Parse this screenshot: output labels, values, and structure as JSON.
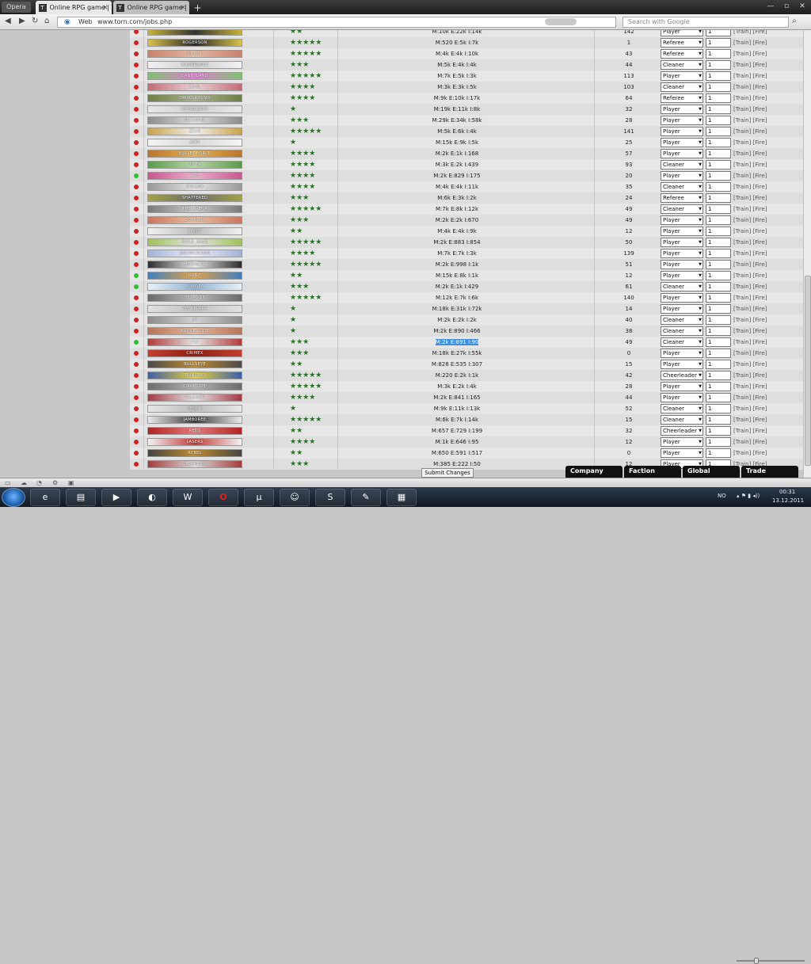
{
  "browser": {
    "menu_label": "Opera",
    "tabs": [
      {
        "label": "Online RPG game | TO...",
        "favicon": "T",
        "active": true
      },
      {
        "label": "Online RPG game | TO...",
        "favicon": "T",
        "active": false
      }
    ],
    "new_tab": "+",
    "address_label": "Web",
    "url": "www.torn.com/jobs.php",
    "search_placeholder": "Search with Google"
  },
  "jobs": {
    "rows": [
      {
        "status": "red",
        "name": "",
        "stars": "★★",
        "stats": "M:10k E:22k I:14k",
        "count": "142",
        "role": "Player",
        "qty": "1",
        "actions": "[Train] [Fire]",
        "colors": [
          "#c9b43a",
          "#333"
        ]
      },
      {
        "status": "red",
        "name": "ROGERSON",
        "stars": "★★★★★",
        "stats": "M:520 E:5k I:7k",
        "count": "1",
        "role": "Referee",
        "qty": "1",
        "actions": "[Train] [Fire]",
        "colors": [
          "#d8c24a",
          "#2a2a2a"
        ]
      },
      {
        "status": "red",
        "name": "JD-LIFT",
        "stars": "★★★★★",
        "stats": "M:4k E:4k I:10k",
        "count": "43",
        "role": "Referee",
        "qty": "1",
        "actions": "[Train] [Fire]",
        "colors": [
          "#c7816a",
          "#e3b9a1"
        ]
      },
      {
        "status": "red",
        "name": "QUADRANGE",
        "stars": "★★★",
        "stats": "M:5k E:4k I:4k",
        "count": "44",
        "role": "Cleaner",
        "qty": "1",
        "actions": "[Train] [Fire]",
        "colors": [
          "#f2f2f2",
          "#cfcfcf"
        ]
      },
      {
        "status": "red",
        "name": "CANDYLAND",
        "stars": "★★★★★",
        "stats": "M:7k E:5k I:3k",
        "count": "113",
        "role": "Player",
        "qty": "1",
        "actions": "[Train] [Fire]",
        "colors": [
          "#7fc36f",
          "#e07bd1"
        ]
      },
      {
        "status": "red",
        "name": "ZOOL",
        "stars": "★★★★",
        "stats": "M:3k E:3k I:5k",
        "count": "103",
        "role": "Cleaner",
        "qty": "1",
        "actions": "[Train] [Fire]",
        "colors": [
          "#c46b78",
          "#e6d3d6"
        ]
      },
      {
        "status": "red",
        "name": "DARKGROUND",
        "stars": "★★★★",
        "stats": "M:9k E:10k I:17k",
        "count": "64",
        "role": "Referee",
        "qty": "1",
        "actions": "[Train] [Fire]",
        "colors": [
          "#6e7f49",
          "#aab38a"
        ]
      },
      {
        "status": "red",
        "name": "DOUBLEDOX",
        "stars": "★",
        "stats": "M:19k E:11k I:8k",
        "count": "32",
        "role": "Player",
        "qty": "1",
        "actions": "[Train] [Fire]",
        "colors": [
          "#e8e8e8",
          "#cfcfcf"
        ]
      },
      {
        "status": "red",
        "name": "OCTOPUS",
        "stars": "★★★",
        "stats": "M:29k E:34k I:58k",
        "count": "28",
        "role": "Player",
        "qty": "1",
        "actions": "[Train] [Fire]",
        "colors": [
          "#8d8d8d",
          "#dcdcdc"
        ]
      },
      {
        "status": "red",
        "name": "ZEUS",
        "stars": "★★★★★",
        "stats": "M:5k E:6k I:4k",
        "count": "141",
        "role": "Player",
        "qty": "1",
        "actions": "[Train] [Fire]",
        "colors": [
          "#c8a24a",
          "#f0f0f0"
        ]
      },
      {
        "status": "red",
        "name": "AXIA",
        "stars": "★",
        "stats": "M:15k E:9k I:5k",
        "count": "25",
        "role": "Player",
        "qty": "1",
        "actions": "[Train] [Fire]",
        "colors": [
          "#f4f4f4",
          "#d9d9d9"
        ]
      },
      {
        "status": "red",
        "name": "BULLET-FORCE",
        "stars": "★★★★",
        "stats": "M:2k E:1k I:168",
        "count": "57",
        "role": "Player",
        "qty": "1",
        "actions": "[Train] [Fire]",
        "colors": [
          "#b8742a",
          "#e4b35a"
        ]
      },
      {
        "status": "red",
        "name": "VIPER",
        "stars": "★★★★",
        "stats": "M:3k E:2k I:439",
        "count": "93",
        "role": "Cleaner",
        "qty": "1",
        "actions": "[Train] [Fire]",
        "colors": [
          "#5b9a4c",
          "#b9d5a8"
        ]
      },
      {
        "status": "green",
        "name": "ZOE",
        "stars": "★★★★",
        "stats": "M:2k E:829 I:175",
        "count": "20",
        "role": "Player",
        "qty": "1",
        "actions": "[Train] [Fire]",
        "colors": [
          "#c7578f",
          "#e9b1cb"
        ]
      },
      {
        "status": "red",
        "name": "FREEKO",
        "stars": "★★★★",
        "stats": "M:4k E:4k I:11k",
        "count": "35",
        "role": "Cleaner",
        "qty": "1",
        "actions": "[Train] [Fire]",
        "colors": [
          "#9a9a9a",
          "#e2e2e2"
        ]
      },
      {
        "status": "red",
        "name": "SHATTERED",
        "stars": "★★★",
        "stats": "M:6k E:3k I:2k",
        "count": "24",
        "role": "Referee",
        "qty": "1",
        "actions": "[Train] [Fire]",
        "colors": [
          "#a3a34a",
          "#6a6a6a"
        ]
      },
      {
        "status": "red",
        "name": "THE ARENA",
        "stars": "★★★★★",
        "stats": "M:7k E:8k I:12k",
        "count": "49",
        "role": "Cleaner",
        "qty": "1",
        "actions": "[Train] [Fire]",
        "colors": [
          "#7a7a7a",
          "#c9c9c9"
        ]
      },
      {
        "status": "red",
        "name": "ZORBLUS",
        "stars": "★★★",
        "stats": "M:2k E:2k I:670",
        "count": "49",
        "role": "Player",
        "qty": "1",
        "actions": "[Train] [Fire]",
        "colors": [
          "#c9765d",
          "#e8c0a4"
        ]
      },
      {
        "status": "red",
        "name": "LIMBO",
        "stars": "★★",
        "stats": "M:4k E:4k I:9k",
        "count": "12",
        "role": "Player",
        "qty": "1",
        "actions": "[Train] [Fire]",
        "colors": [
          "#f0f0f0",
          "#bdbdbd"
        ]
      },
      {
        "status": "red",
        "name": "GOLD_BASE",
        "stars": "★★★★★",
        "stats": "M:2k E:883 I:854",
        "count": "50",
        "role": "Player",
        "qty": "1",
        "actions": "[Train] [Fire]",
        "colors": [
          "#a0c15a",
          "#e4e4e4"
        ]
      },
      {
        "status": "red",
        "name": "SNOWCROWN",
        "stars": "★★★★",
        "stats": "M:7k E:7k I:3k",
        "count": "139",
        "role": "Player",
        "qty": "1",
        "actions": "[Train] [Fire]",
        "colors": [
          "#a6b3d9",
          "#eaeaf4"
        ]
      },
      {
        "status": "red",
        "name": "HORNETS",
        "stars": "★★★★★",
        "stats": "M:2k E:998 I:1k",
        "count": "51",
        "role": "Player",
        "qty": "1",
        "actions": "[Train] [Fire]",
        "colors": [
          "#2d2d2d",
          "#e8e8e8"
        ]
      },
      {
        "status": "green",
        "name": "ORBIT",
        "stars": "★★",
        "stats": "M:15k E:8k I:1k",
        "count": "12",
        "role": "Player",
        "qty": "1",
        "actions": "[Train] [Fire]",
        "colors": [
          "#3f7fc2",
          "#e3a241"
        ]
      },
      {
        "status": "green",
        "name": "AURORA",
        "stars": "★★★",
        "stats": "M:2k E:1k I:429",
        "count": "61",
        "role": "Cleaner",
        "qty": "1",
        "actions": "[Train] [Fire]",
        "colors": [
          "#e9f1f7",
          "#8fb2d3"
        ]
      },
      {
        "status": "red",
        "name": "HEXAGON",
        "stars": "★★★★★",
        "stats": "M:12k E:7k I:6k",
        "count": "140",
        "role": "Player",
        "qty": "1",
        "actions": "[Train] [Fire]",
        "colors": [
          "#6a6a6a",
          "#bdbdbd"
        ]
      },
      {
        "status": "red",
        "name": "WHITEPARK",
        "stars": "★",
        "stats": "M:18k E:31k I:72k",
        "count": "14",
        "role": "Player",
        "qty": "1",
        "actions": "[Train] [Fire]",
        "colors": [
          "#e0e0e0",
          "#c2c2c2"
        ]
      },
      {
        "status": "red",
        "name": "SP",
        "stars": "★",
        "stats": "M:2k E:2k I:2k",
        "count": "40",
        "role": "Cleaner",
        "qty": "1",
        "actions": "[Train] [Fire]",
        "colors": [
          "#8c8c8c",
          "#d1d1d1"
        ]
      },
      {
        "status": "red",
        "name": "BROKENSIDE",
        "stars": "★",
        "stats": "M:2k E:890 I:466",
        "count": "38",
        "role": "Cleaner",
        "qty": "1",
        "actions": "[Train] [Fire]",
        "colors": [
          "#b5755a",
          "#e5b69c"
        ]
      },
      {
        "status": "green",
        "name": "FLY",
        "stars": "★★★",
        "stats": "M:2k E:891 I:90",
        "count": "49",
        "role": "Cleaner",
        "qty": "1",
        "actions": "[Train] [Fire]",
        "colors": [
          "#b23a3a",
          "#e4e4e4"
        ],
        "highlight": true
      },
      {
        "status": "red",
        "name": "CRIMEX",
        "stars": "★★★",
        "stats": "M:18k E:27k I:55k",
        "count": "0",
        "role": "Player",
        "qty": "1",
        "actions": "[Train] [Fire]",
        "colors": [
          "#c33f2e",
          "#8e1f16"
        ]
      },
      {
        "status": "red",
        "name": "BULLSEYE",
        "stars": "★★",
        "stats": "M:828 E:535 I:307",
        "count": "15",
        "role": "Player",
        "qty": "1",
        "actions": "[Train] [Fire]",
        "colors": [
          "#4b4b4b",
          "#c28a2e"
        ]
      },
      {
        "status": "red",
        "name": "TRINIDAD",
        "stars": "★★★★★",
        "stats": "M:220 E:2k I:1k",
        "count": "42",
        "role": "Cheerleader",
        "qty": "1",
        "actions": "[Train] [Fire]",
        "colors": [
          "#3f5fa8",
          "#e4cf3c"
        ]
      },
      {
        "status": "red",
        "name": "DARKSIDE",
        "stars": "★★★★★",
        "stats": "M:3k E:2k I:4k",
        "count": "28",
        "role": "Player",
        "qty": "1",
        "actions": "[Train] [Fire]",
        "colors": [
          "#6d6d6d",
          "#b1b1b1"
        ]
      },
      {
        "status": "red",
        "name": "VALEDOR",
        "stars": "★★★★",
        "stats": "M:2k E:841 I:165",
        "count": "44",
        "role": "Player",
        "qty": "1",
        "actions": "[Train] [Fire]",
        "colors": [
          "#a33a45",
          "#e6e6e6"
        ]
      },
      {
        "status": "red",
        "name": "SHOCK",
        "stars": "★",
        "stats": "M:9k E:11k I:13k",
        "count": "52",
        "role": "Cleaner",
        "qty": "1",
        "actions": "[Train] [Fire]",
        "colors": [
          "#e7e7e7",
          "#bcbcbc"
        ]
      },
      {
        "status": "red",
        "name": "JAMBOREE",
        "stars": "★★★★★",
        "stats": "M:6k E:7k I:14k",
        "count": "15",
        "role": "Cleaner",
        "qty": "1",
        "actions": "[Train] [Fire]",
        "colors": [
          "#e9e9e9",
          "#3c3c3c"
        ]
      },
      {
        "status": "red",
        "name": "REDS",
        "stars": "★★",
        "stats": "M:657 E:729 I:199",
        "count": "32",
        "role": "Cheerleader",
        "qty": "1",
        "actions": "[Train] [Fire]",
        "colors": [
          "#b22424",
          "#e37a7a"
        ]
      },
      {
        "status": "red",
        "name": "LASERS",
        "stars": "★★★★",
        "stats": "M:1k E:646 I:95",
        "count": "12",
        "role": "Player",
        "qty": "1",
        "actions": "[Train] [Fire]",
        "colors": [
          "#f2f2f2",
          "#c23a3a"
        ]
      },
      {
        "status": "red",
        "name": "REBEL",
        "stars": "★★",
        "stats": "M:650 E:591 I:517",
        "count": "0",
        "role": "Player",
        "qty": "1",
        "actions": "[Train] [Fire]",
        "colors": [
          "#444",
          "#c18b2c"
        ]
      },
      {
        "status": "red",
        "name": "RECORDER",
        "stars": "★★★",
        "stats": "M:385 E:222 I:50",
        "count": "12",
        "role": "Player",
        "qty": "1",
        "actions": "[Train] [Fire]",
        "colors": [
          "#a33c3c",
          "#d9d9d9"
        ]
      }
    ]
  },
  "submit_label": "Submit Changes",
  "dock_tabs": [
    "Company",
    "Faction",
    "Global",
    "Trade"
  ],
  "taskbar": {
    "apps": [
      "ie-icon",
      "folder-icon",
      "media-player-icon",
      "steam-icon",
      "wow-icon",
      "opera-icon",
      "utorrent-icon",
      "messenger-icon",
      "skype-icon",
      "paint-icon",
      "calculator-icon"
    ],
    "language": "NO",
    "time": "00:31",
    "date": "13.12.2011"
  },
  "colors": {
    "green": "#2fbf2f",
    "red": "#cc2222"
  }
}
